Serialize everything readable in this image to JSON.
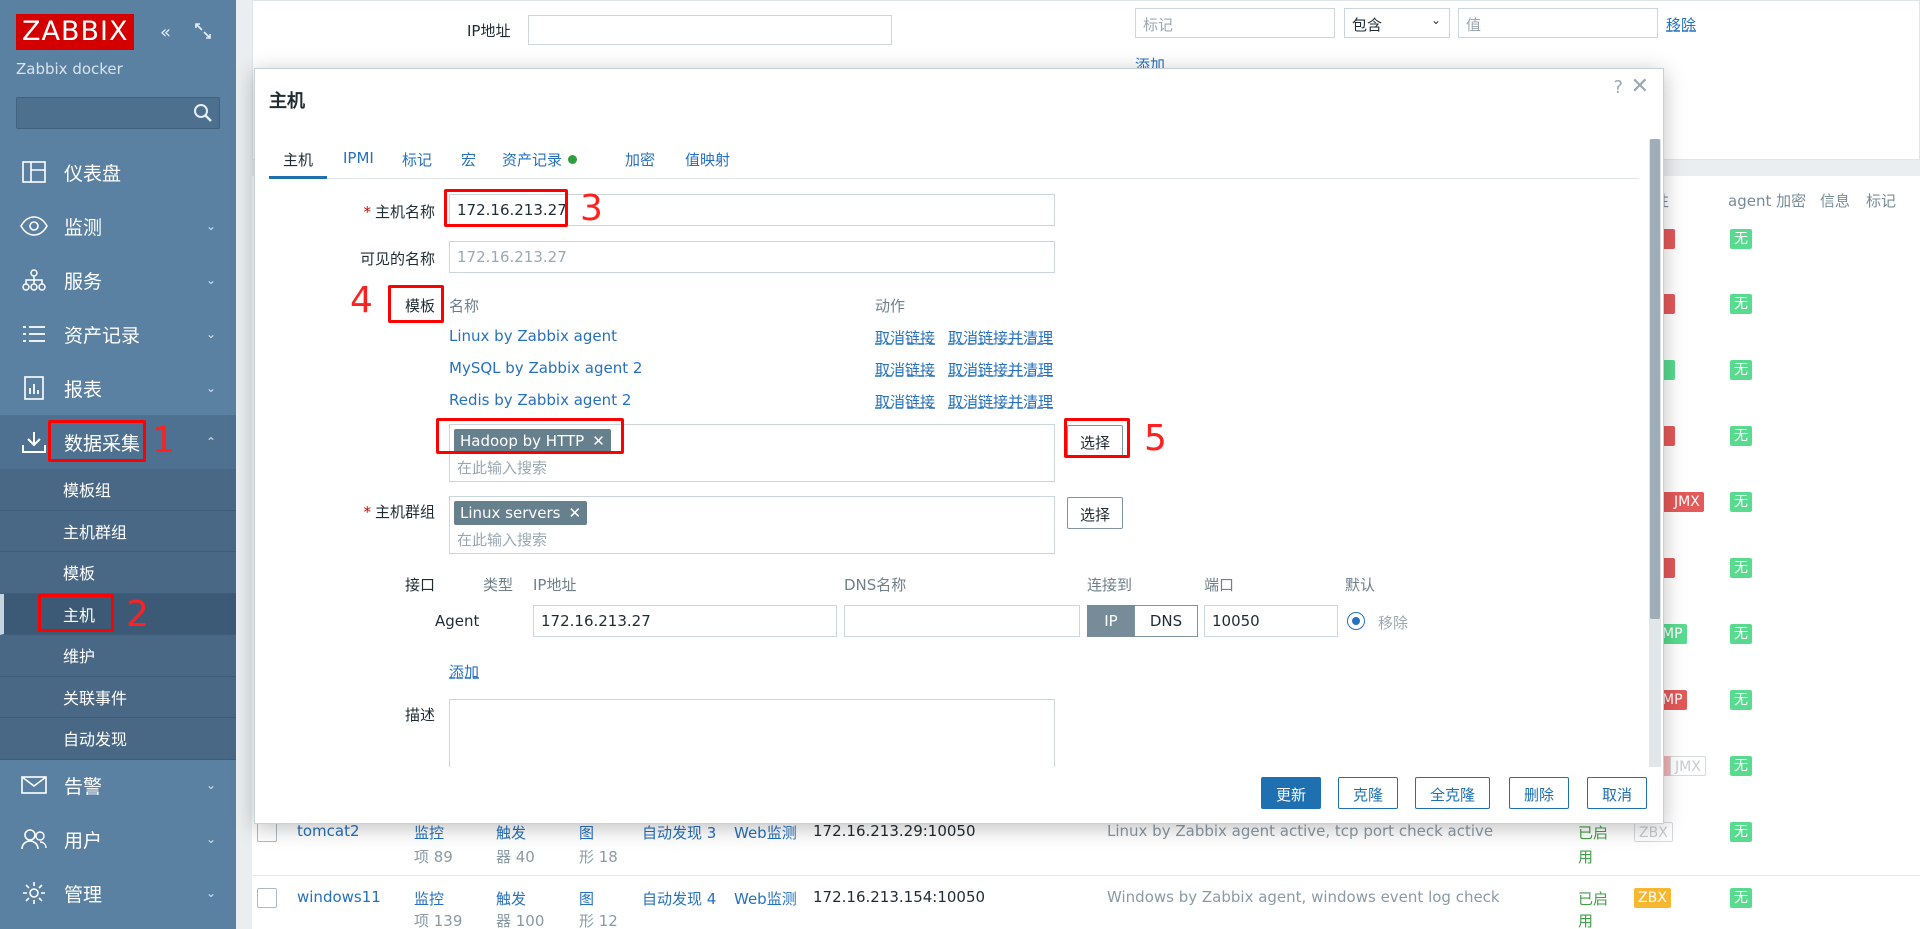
{
  "sidebar": {
    "logo": "ZABBIX",
    "server_name": "Zabbix docker",
    "menu": [
      {
        "label": "仪表盘",
        "icon": "dashboard-icon"
      },
      {
        "label": "监测",
        "icon": "eye-icon"
      },
      {
        "label": "服务",
        "icon": "services-icon"
      },
      {
        "label": "资产记录",
        "icon": "list-icon"
      },
      {
        "label": "报表",
        "icon": "report-icon"
      },
      {
        "label": "数据采集",
        "icon": "download-icon"
      }
    ],
    "submenu": [
      "模板组",
      "主机群组",
      "模板",
      "主机",
      "维护",
      "关联事件",
      "自动发现"
    ],
    "menu_bottom": [
      {
        "label": "告警",
        "icon": "mail-icon"
      },
      {
        "label": "用户",
        "icon": "users-icon"
      },
      {
        "label": "管理",
        "icon": "gear-icon"
      }
    ]
  },
  "background": {
    "filter": {
      "ip_label": "IP地址",
      "tag_placeholder": "标记",
      "operator": "包含",
      "value_placeholder": "值",
      "remove": "移除",
      "add": "添加"
    },
    "columns": [
      "性",
      "agent 加密",
      "信息",
      "标记"
    ],
    "rows": [
      {
        "name": "tomcat2",
        "items": "监控项 89",
        "items_l1": "监控",
        "items_l2": "项 89",
        "triggers_l1": "触发",
        "triggers_l2": "器 40",
        "graphs_l1": "图",
        "graphs_l2": "形 18",
        "discovery": "自动发现 3",
        "web": "Web监测",
        "interface": "172.16.213.29:10050",
        "templates": "Linux by Zabbix agent active, tcp port check active",
        "status_l1": "已启",
        "status_l2": "用",
        "avail": "ZBX"
      },
      {
        "name": "windows11",
        "items_l1": "监控",
        "items_l2": "项 139",
        "triggers_l1": "触发",
        "triggers_l2": "器 100",
        "graphs_l1": "图",
        "graphs_l2": "形 12",
        "discovery": "自动发现 4",
        "web": "Web监测",
        "interface": "172.16.213.154:10050",
        "templates": "Windows by Zabbix agent, windows event log check",
        "status_l1": "已启",
        "status_l2": "用",
        "avail": "ZBX"
      }
    ],
    "tag_none": "无",
    "tag_jmx": "JMX",
    "tag_mp": "MP"
  },
  "modal": {
    "title": "主机",
    "help": "?",
    "close": "✕",
    "tabs": [
      "主机",
      "IPMI",
      "标记",
      "宏",
      "资产记录",
      "加密",
      "值映射"
    ],
    "hostname_label": "主机名称",
    "hostname_value": "172.16.213.27",
    "visible_label": "可见的名称",
    "visible_placeholder": "172.16.213.27",
    "templates_label": "模板",
    "col_name": "名称",
    "col_action": "动作",
    "templates": [
      {
        "name": "Linux by Zabbix agent",
        "unlink": "取消链接",
        "unlink_clear": "取消链接并清理"
      },
      {
        "name": "MySQL by Zabbix agent 2",
        "unlink": "取消链接",
        "unlink_clear": "取消链接并清理"
      },
      {
        "name": "Redis by Zabbix agent 2",
        "unlink": "取消链接",
        "unlink_clear": "取消链接并清理"
      }
    ],
    "new_template_chip": "Hadoop by HTTP",
    "search_placeholder": "在此输入搜索",
    "select_button": "选择",
    "hostgroups_label": "主机群组",
    "hostgroup_chip": "Linux servers",
    "interfaces_label": "接口",
    "iface_headers": {
      "type": "类型",
      "ip": "IP地址",
      "dns": "DNS名称",
      "connect": "连接到",
      "port": "端口",
      "default": "默认"
    },
    "iface": {
      "type": "Agent",
      "ip": "172.16.213.27",
      "dns": "",
      "conn_ip": "IP",
      "conn_dns": "DNS",
      "port": "10050",
      "remove": "移除"
    },
    "add_interface": "添加",
    "description_label": "描述",
    "footer": [
      "更新",
      "克隆",
      "全克隆",
      "删除",
      "取消"
    ]
  },
  "annotations": [
    "1",
    "2",
    "3",
    "4",
    "5"
  ]
}
